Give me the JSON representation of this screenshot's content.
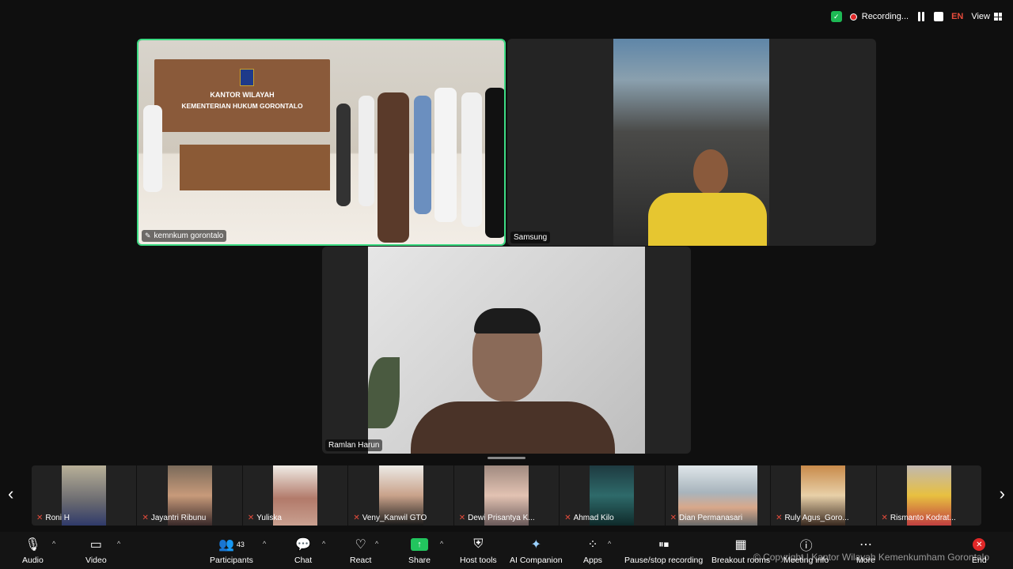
{
  "topbar": {
    "recording_label": "Recording...",
    "language": "EN",
    "view_label": "View"
  },
  "tiles": {
    "main": "kemnkum gorontalo",
    "samsung": "Samsung",
    "speaker": "Ramlan Harun"
  },
  "room": {
    "sign_line1": "KANTOR WILAYAH",
    "sign_line2": "KEMENTERIAN HUKUM GORONTALO"
  },
  "participants_strip": [
    "Roni H",
    "Jayantri Ribunu",
    "Yuliska",
    "Veny_Kanwil GTO",
    "Dewi Prisantya K...",
    "Ahmad Kilo",
    "Dian Permanasari",
    "Ruly Agus_Goro...",
    "Rismanto Kodrat..."
  ],
  "toolbar": {
    "audio": "Audio",
    "video": "Video",
    "participants": "Participants",
    "participants_count": "43",
    "chat": "Chat",
    "react": "React",
    "share": "Share",
    "host_tools": "Host tools",
    "ai_companion": "AI Companion",
    "apps": "Apps",
    "recording": "Pause/stop recording",
    "breakout": "Breakout rooms",
    "meeting_info": "Meeting info",
    "more": "More",
    "end": "End"
  },
  "copyright": "© Copyright | Kantor Wilayah Kemenkumham Gorontalo",
  "colors": {
    "accent_green": "#22c55e",
    "end_red": "#e02828",
    "active_border": "#3ddc84"
  }
}
